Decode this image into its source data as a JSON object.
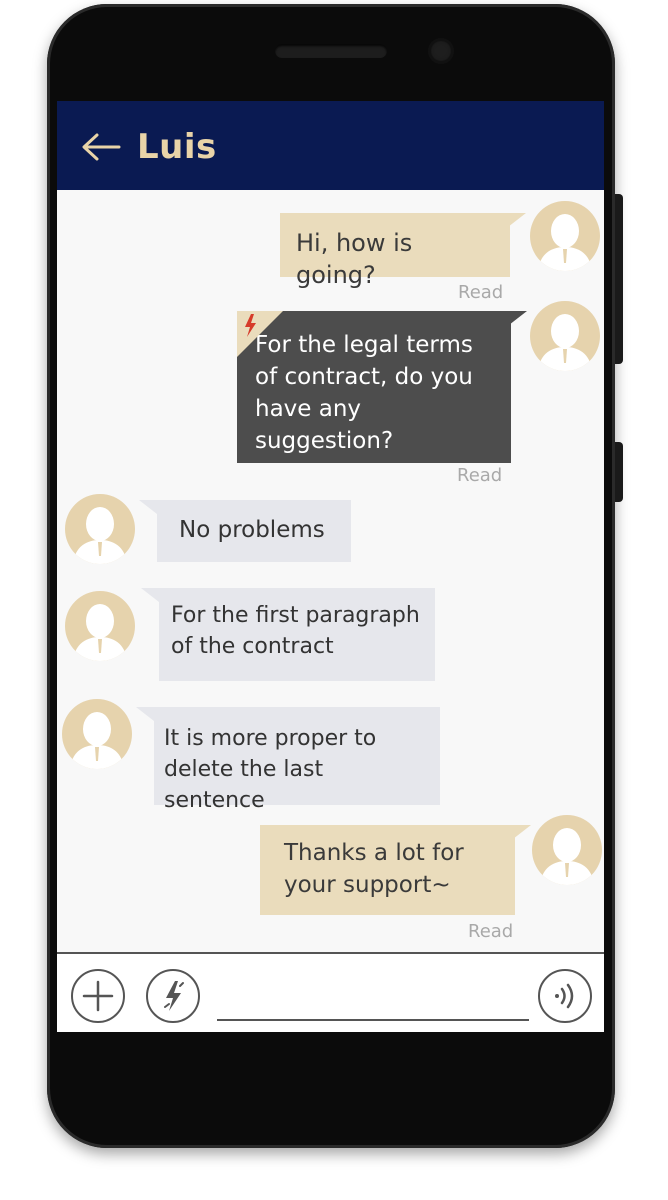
{
  "header": {
    "title": "Luis",
    "back_icon": "arrow-left-icon"
  },
  "messages": [
    {
      "side": "out",
      "text": "Hi, how is going?",
      "status": "Read"
    },
    {
      "side": "out",
      "style": "flash",
      "text_lines": [
        "For the legal terms",
        "of contract, do you",
        "have any suggestion?"
      ],
      "status": "Read"
    },
    {
      "side": "in",
      "text": "No problems"
    },
    {
      "side": "in",
      "text_lines": [
        "For the first paragraph",
        "of the contract"
      ]
    },
    {
      "side": "in",
      "text_lines": [
        "It is more proper to",
        "delete the last sentence"
      ]
    },
    {
      "side": "out",
      "text_lines": [
        "Thanks a lot for",
        "your support~"
      ],
      "status": "Read"
    }
  ],
  "input_bar": {
    "add_icon": "plus-icon",
    "flash_icon": "lightning-icon",
    "voice_icon": "sound-waves-icon",
    "placeholder": ""
  },
  "colors": {
    "header_bg": "#0a1a52",
    "title": "#e9d4a8",
    "outgoing_bubble": "#eadcbc",
    "flash_bubble": "#4d4d4d",
    "incoming_bubble": "#e6e7ec",
    "avatar": "#e6d3ad",
    "flash_accent": "#d63b2a"
  }
}
